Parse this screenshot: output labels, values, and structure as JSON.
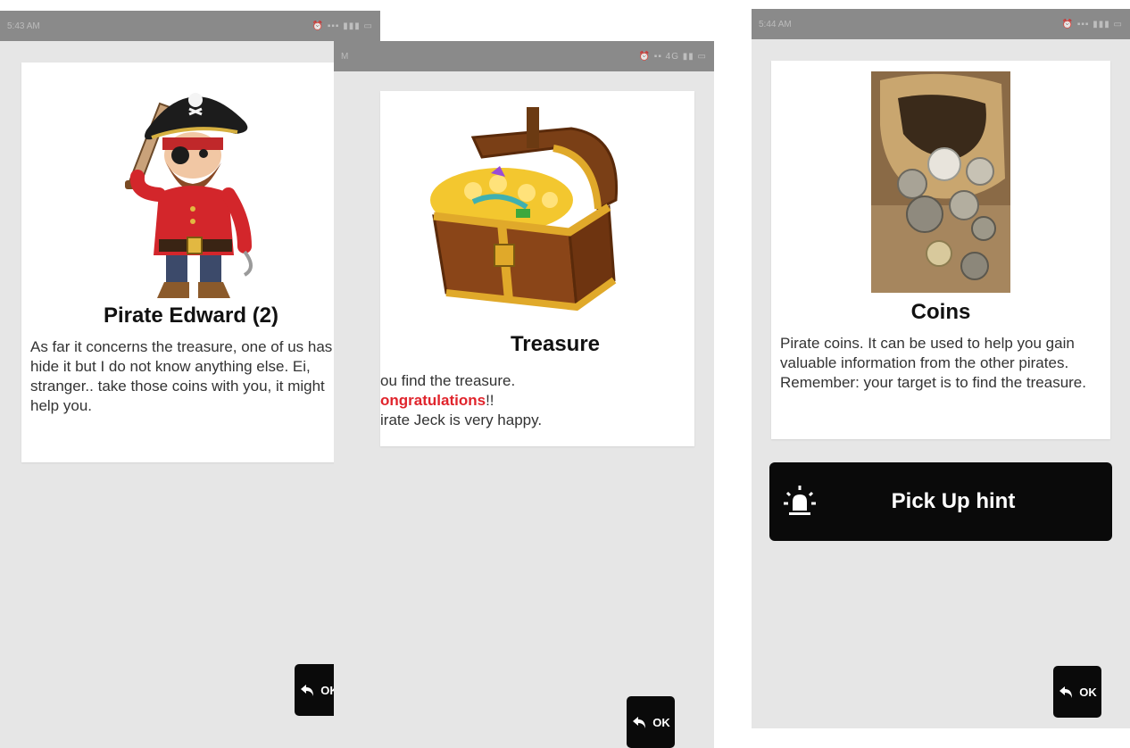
{
  "screens": [
    {
      "status": {
        "time": "5:43 AM",
        "icons": "⏰ ▪▪▪ ▮▮▮ ▭"
      },
      "card": {
        "image_icon": "pirate-captain-illustration",
        "title": "Pirate Edward (2)",
        "body": "As far it concerns the treasure, one of us has to hide it but I do not know anything else.  Ei, stranger.. take those coins with you, it might help you."
      },
      "ok_button": {
        "label": "OK",
        "icon": "undo-arrow-icon"
      }
    },
    {
      "status": {
        "time": "M",
        "icons": "⏰ ▪▪ 4G ▮▮ ▭"
      },
      "card": {
        "image_icon": "treasure-chest-illustration",
        "title": "Treasure",
        "line1": "ou find the treasure.",
        "line2_highlight": "ongratulations",
        "line2_rest": "!!",
        "line3": "irate Jeck is very happy."
      },
      "ok_button": {
        "label": "OK",
        "icon": "undo-arrow-icon"
      }
    },
    {
      "status": {
        "time": "5:44 AM",
        "icons": "⏰ ▪▪▪ ▮▮▮ ▭"
      },
      "card": {
        "image_icon": "coins-bag-photo",
        "title": "Coins",
        "body": "Pirate coins. It can be used to help you gain valuable information from the other pirates. Remember: your target is to find the treasure."
      },
      "hint_button": {
        "label": "Pick Up hint",
        "icon": "siren-light-icon"
      },
      "ok_button": {
        "label": "OK",
        "icon": "undo-arrow-icon"
      }
    }
  ],
  "colors": {
    "screen_bg": "#e6e6e6",
    "status_bar": "#8a8a8a",
    "button_bg": "#0a0a0a",
    "highlight_red": "#e0242c"
  }
}
